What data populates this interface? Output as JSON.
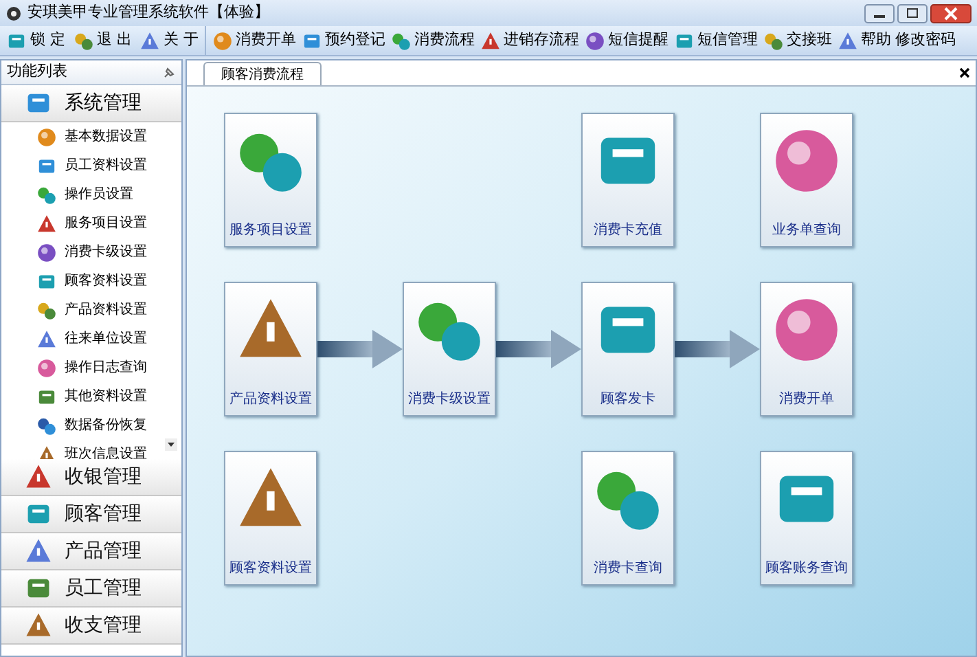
{
  "window": {
    "title": "安琪美甲专业管理系统软件【体验】"
  },
  "toolbar": {
    "left": [
      {
        "label": "锁 定"
      },
      {
        "label": "退 出"
      },
      {
        "label": "关 于"
      }
    ],
    "right": [
      {
        "label": "消费开单",
        "kind": "icon"
      },
      {
        "label": "预约登记",
        "kind": "icon"
      },
      {
        "label": "消费流程",
        "kind": "icon"
      },
      {
        "label": "进销存流程",
        "kind": "icon"
      },
      {
        "label": "短信提醒",
        "kind": "icon"
      },
      {
        "label": "短信管理",
        "kind": "icon"
      },
      {
        "label": "交接班",
        "kind": "icon"
      },
      {
        "label": "帮助",
        "kind": "icon"
      },
      {
        "label": "修改密码",
        "kind": "text"
      }
    ]
  },
  "sidebar": {
    "title": "功能列表",
    "groups": [
      {
        "label": "系统管理",
        "expanded": true,
        "items": [
          "基本数据设置",
          "员工资料设置",
          "操作员设置",
          "服务项目设置",
          "消费卡级设置",
          "顾客资料设置",
          "产品资料设置",
          "往来单位设置",
          "操作日志查询",
          "其他资料设置",
          "数据备份恢复",
          "班次信息设置"
        ]
      },
      {
        "label": "收银管理",
        "expanded": false
      },
      {
        "label": "顾客管理",
        "expanded": false
      },
      {
        "label": "产品管理",
        "expanded": false
      },
      {
        "label": "员工管理",
        "expanded": false
      },
      {
        "label": "收支管理",
        "expanded": false
      }
    ]
  },
  "tabs": [
    {
      "label": "顾客消费流程",
      "selected": true
    }
  ],
  "flow": {
    "rows": [
      [
        {
          "kind": "tile",
          "label": "服务项目设置"
        },
        {
          "kind": "blank"
        },
        {
          "kind": "blank"
        },
        {
          "kind": "blank"
        },
        {
          "kind": "tile",
          "label": "消费卡充值"
        },
        {
          "kind": "blank"
        },
        {
          "kind": "tile",
          "label": "业务单查询"
        }
      ],
      [
        {
          "kind": "tile",
          "label": "产品资料设置"
        },
        {
          "kind": "arrow"
        },
        {
          "kind": "tile",
          "label": "消费卡级设置"
        },
        {
          "kind": "arrow"
        },
        {
          "kind": "tile",
          "label": "顾客发卡"
        },
        {
          "kind": "arrow"
        },
        {
          "kind": "tile",
          "label": "消费开单"
        }
      ],
      [
        {
          "kind": "tile",
          "label": "顾客资料设置"
        },
        {
          "kind": "blank"
        },
        {
          "kind": "blank"
        },
        {
          "kind": "blank"
        },
        {
          "kind": "tile",
          "label": "消费卡查询"
        },
        {
          "kind": "blank"
        },
        {
          "kind": "tile",
          "label": "顾客账务查询"
        }
      ]
    ]
  }
}
